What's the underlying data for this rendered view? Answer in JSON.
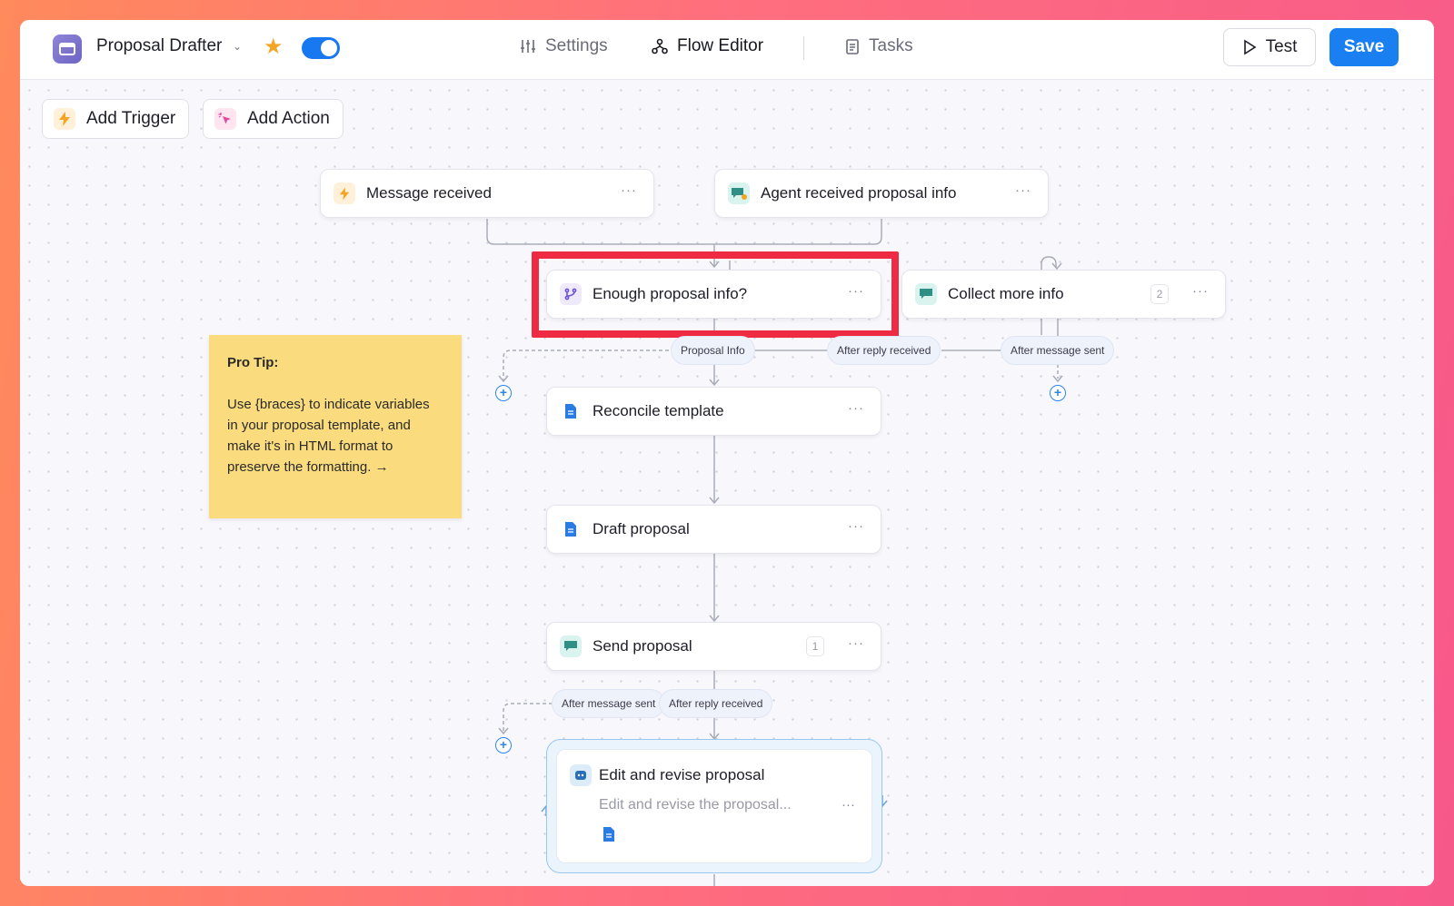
{
  "app": {
    "name": "Proposal Drafter",
    "enabled": true,
    "favorite": true
  },
  "tabs": [
    {
      "label": "Settings",
      "icon": "sliders-icon",
      "active": false
    },
    {
      "label": "Flow Editor",
      "icon": "flow-icon",
      "active": true
    },
    {
      "label": "Tasks",
      "icon": "clipboard-icon",
      "active": false
    }
  ],
  "actions": {
    "test_label": "Test",
    "save_label": "Save"
  },
  "toolbar": {
    "add_trigger": "Add Trigger",
    "add_action": "Add Action"
  },
  "sticky_note": {
    "title": "Pro Tip:",
    "body": "Use {braces} to indicate variables in your proposal template, and make it's in HTML format to preserve the formatting. →"
  },
  "nodes": {
    "message_received": {
      "label": "Message received",
      "icon": "lightning-icon"
    },
    "agent_received": {
      "label": "Agent received proposal info",
      "icon": "chat-agent-icon"
    },
    "enough_info": {
      "label": "Enough proposal info?",
      "icon": "branch-icon"
    },
    "collect_more": {
      "label": "Collect more info",
      "icon": "chat-icon",
      "count": "2"
    },
    "reconcile": {
      "label": "Reconcile template",
      "icon": "document-icon"
    },
    "draft": {
      "label": "Draft proposal",
      "icon": "document-icon"
    },
    "send": {
      "label": "Send proposal",
      "icon": "chat-icon",
      "count": "1"
    },
    "edit_revise": {
      "label": "Edit and revise proposal",
      "description": "Edit and revise the proposal...",
      "icon": "agent-icon"
    }
  },
  "edge_labels": {
    "proposal_info": "Proposal Info",
    "after_reply_1": "After reply received",
    "after_message_1": "After message sent",
    "after_message_2": "After message sent",
    "after_reply_2": "After reply received"
  },
  "more_label": "···",
  "colors": {
    "accent": "#1a7ff0",
    "highlight": "#ef2b44",
    "sticky": "#fadc7e"
  }
}
